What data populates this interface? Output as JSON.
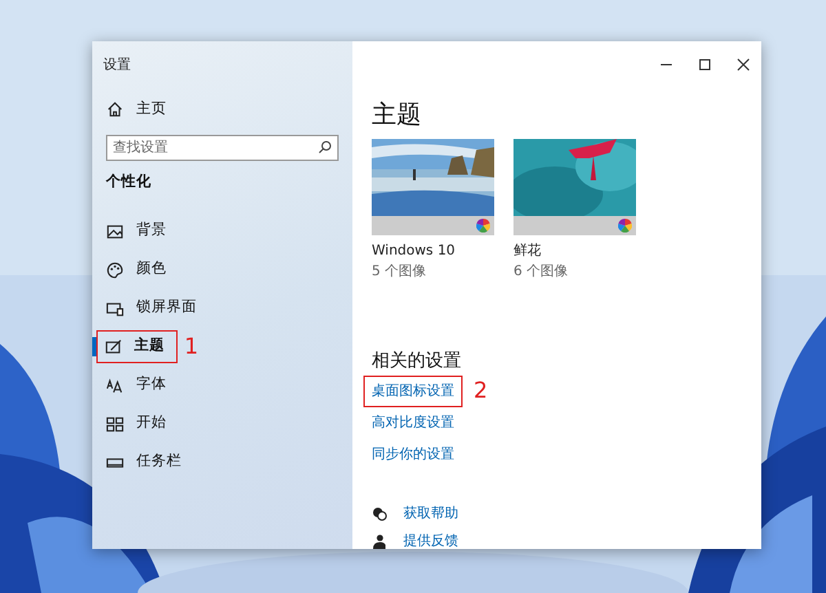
{
  "window": {
    "title": "设置"
  },
  "sidebar": {
    "home": "主页",
    "search": {
      "placeholder": "查找设置"
    },
    "heading": "个性化",
    "items": [
      {
        "label": "背景",
        "selected": false
      },
      {
        "label": "颜色",
        "selected": false
      },
      {
        "label": "锁屏界面",
        "selected": false
      },
      {
        "label": "主题",
        "selected": true,
        "callout": "1"
      },
      {
        "label": "字体",
        "selected": false
      },
      {
        "label": "开始",
        "selected": false
      },
      {
        "label": "任务栏",
        "selected": false
      }
    ]
  },
  "main": {
    "title": "主题",
    "themes": [
      {
        "name": "Windows 10",
        "count": "5 个图像",
        "kind": "picture"
      },
      {
        "name": "鲜花",
        "count": "6 个图像",
        "kind": "picture"
      }
    ],
    "related": {
      "heading": "相关的设置",
      "links": [
        {
          "label": "桌面图标设置",
          "callout": "2"
        },
        {
          "label": "高对比度设置"
        },
        {
          "label": "同步你的设置"
        }
      ]
    },
    "help": [
      {
        "label": "获取帮助"
      },
      {
        "label": "提供反馈"
      }
    ]
  }
}
